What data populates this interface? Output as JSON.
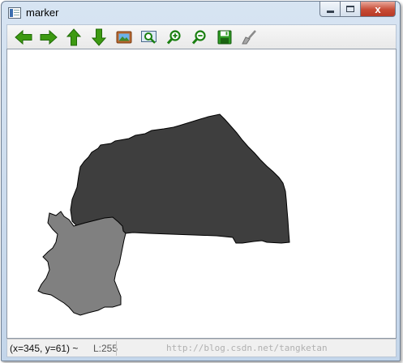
{
  "window": {
    "title": "marker",
    "minimize_label": "",
    "maximize_label": "",
    "close_label": "x"
  },
  "toolbar": {
    "buttons": [
      {
        "name": "pan-left-button",
        "icon": "arrow-left-icon"
      },
      {
        "name": "pan-right-button",
        "icon": "arrow-right-icon"
      },
      {
        "name": "pan-up-button",
        "icon": "arrow-up-icon"
      },
      {
        "name": "pan-down-button",
        "icon": "arrow-down-icon"
      },
      {
        "name": "fit-image-button",
        "icon": "image-icon"
      },
      {
        "name": "zoom-region-button",
        "icon": "zoom-region-icon"
      },
      {
        "name": "zoom-in-button",
        "icon": "zoom-in-icon"
      },
      {
        "name": "zoom-out-button",
        "icon": "zoom-out-icon"
      },
      {
        "name": "save-button",
        "icon": "floppy-disk-icon"
      },
      {
        "name": "properties-button",
        "icon": "brush-icon"
      }
    ],
    "arrow_color": "#3d9a12",
    "icon_accent": "#1a7f10"
  },
  "canvas": {
    "background_color": "#ffffff",
    "regions": [
      {
        "name": "dark-region",
        "fill": "#3e3e3e"
      },
      {
        "name": "light-region",
        "fill": "#808080"
      }
    ],
    "outline_color": "#000000"
  },
  "status": {
    "position_text": "(x=345, y=61) ~",
    "luminance_text": "L:255"
  },
  "watermark": {
    "text": "http://blog.csdn.net/tangketan"
  }
}
